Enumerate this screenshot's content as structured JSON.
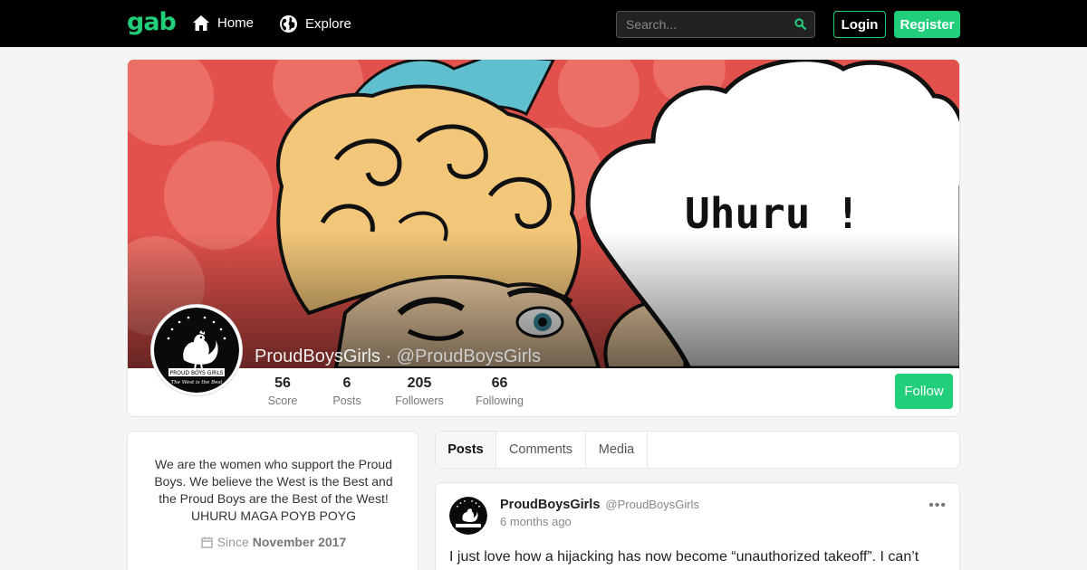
{
  "nav": {
    "logo": "gab",
    "home_label": "Home",
    "explore_label": "Explore",
    "search_placeholder": "Search...",
    "login_label": "Login",
    "register_label": "Register"
  },
  "profile": {
    "cover_text": "Uhuru !",
    "display_name": "ProudBoysGirls",
    "separator": " · ",
    "handle": "@ProudBoysGirls",
    "avatar_banner": "PROUD BOYS GIRLS",
    "avatar_motto": "The West is the Best",
    "stats": [
      {
        "value": "56",
        "label": "Score"
      },
      {
        "value": "6",
        "label": "Posts"
      },
      {
        "value": "205",
        "label": "Followers"
      },
      {
        "value": "66",
        "label": "Following"
      }
    ],
    "follow_label": "Follow"
  },
  "bio": {
    "text": "We are the women who support the Proud Boys. We believe the West is the Best and the Proud Boys are the Best of the West! UHURU MAGA POYB POYG",
    "since_label": "Since",
    "since_date": "November 2017"
  },
  "tabs": [
    {
      "label": "Posts",
      "active": true
    },
    {
      "label": "Comments",
      "active": false
    },
    {
      "label": "Media",
      "active": false
    }
  ],
  "post": {
    "author": "ProudBoysGirls",
    "handle": "@ProudBoysGirls",
    "time": "6 months ago",
    "more": "•••",
    "body": "I just love how a hijacking has now become “unauthorized takeoff”.  I can’t"
  },
  "colors": {
    "brand": "#21cf7a",
    "topbar": "#000000",
    "background": "#f5f5f5"
  }
}
